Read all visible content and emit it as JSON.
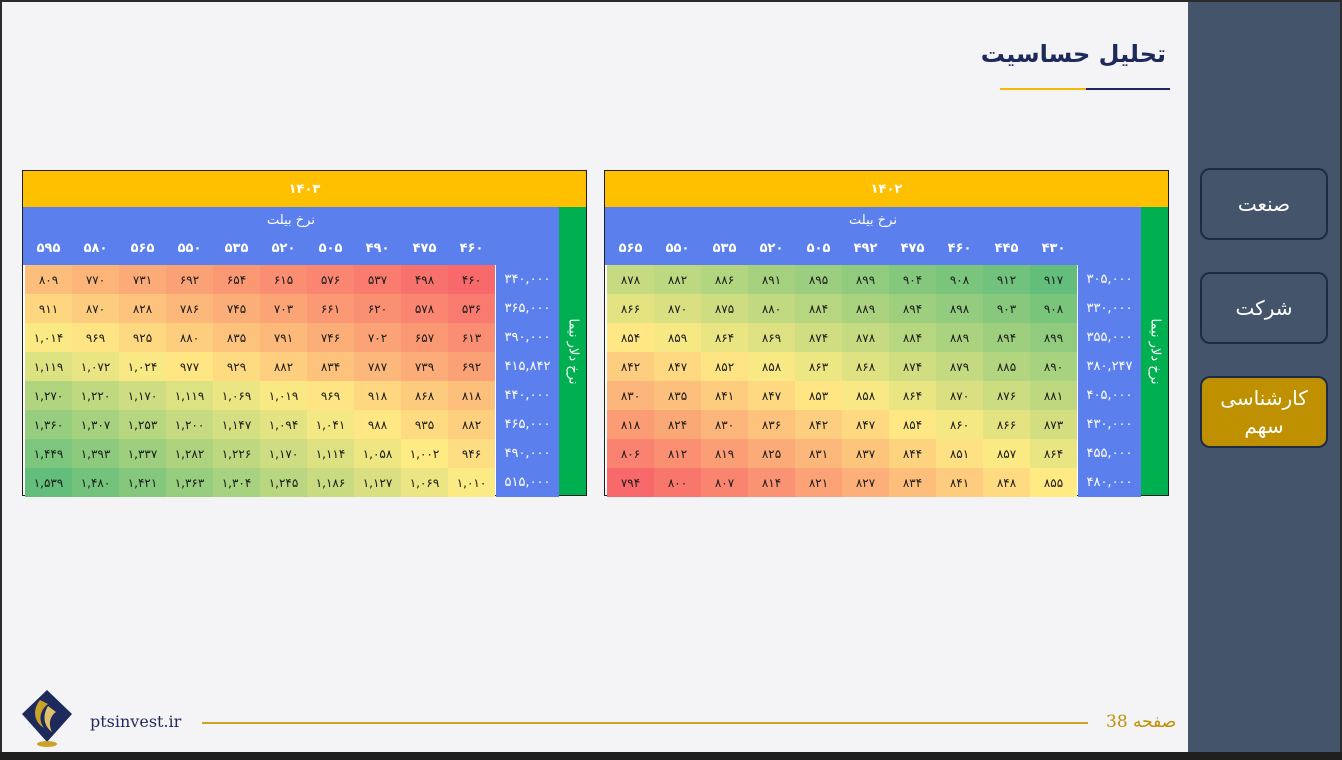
{
  "title": "تحلیل حساسیت",
  "nav": [
    {
      "label": "صنعت",
      "active": false
    },
    {
      "label": "شرکت",
      "active": false
    },
    {
      "label": "کارشناسی سهم",
      "active": true
    }
  ],
  "footer": {
    "site": "ptsinvest.ir",
    "page": "صفحه 38"
  },
  "ticket_label": "نرخ بیلت",
  "dollar_label": "نرخ دلار نیما",
  "colors": {
    "red": "#f8696b",
    "yellow": "#ffeb84",
    "green": "#63be7b",
    "header_blue": "#5b80ee",
    "header_gold": "#ffc000",
    "side_green": "#00b050"
  },
  "tables": [
    {
      "year": "۱۴۰۳",
      "low_is_red": true,
      "cols": [
        "۴۶۰",
        "۴۷۵",
        "۴۹۰",
        "۵۰۵",
        "۵۲۰",
        "۵۳۵",
        "۵۵۰",
        "۵۶۵",
        "۵۸۰",
        "۵۹۵"
      ],
      "rows": [
        "۳۴۰,۰۰۰",
        "۳۶۵,۰۰۰",
        "۳۹۰,۰۰۰",
        "۴۱۵,۸۴۲",
        "۴۴۰,۰۰۰",
        "۴۶۵,۰۰۰",
        "۴۹۰,۰۰۰",
        "۵۱۵,۰۰۰"
      ],
      "cells": [
        [
          "۴۶۰",
          "۴۹۸",
          "۵۳۷",
          "۵۷۶",
          "۶۱۵",
          "۶۵۴",
          "۶۹۲",
          "۷۳۱",
          "۷۷۰",
          "۸۰۹"
        ],
        [
          "۵۳۶",
          "۵۷۸",
          "۶۲۰",
          "۶۶۱",
          "۷۰۳",
          "۷۴۵",
          "۷۸۶",
          "۸۲۸",
          "۸۷۰",
          "۹۱۱"
        ],
        [
          "۶۱۳",
          "۶۵۷",
          "۷۰۲",
          "۷۴۶",
          "۷۹۱",
          "۸۳۵",
          "۸۸۰",
          "۹۲۵",
          "۹۶۹",
          "۱,۰۱۴"
        ],
        [
          "۶۹۲",
          "۷۳۹",
          "۷۸۷",
          "۸۳۴",
          "۸۸۲",
          "۹۲۹",
          "۹۷۷",
          "۱,۰۲۴",
          "۱,۰۷۲",
          "۱,۱۱۹"
        ],
        [
          "۸۱۸",
          "۸۶۸",
          "۹۱۸",
          "۹۶۹",
          "۱,۰۱۹",
          "۱,۰۶۹",
          "۱,۱۱۹",
          "۱,۱۷۰",
          "۱,۲۲۰",
          "۱,۲۷۰"
        ],
        [
          "۸۸۲",
          "۹۳۵",
          "۹۸۸",
          "۱,۰۴۱",
          "۱,۰۹۴",
          "۱,۱۴۷",
          "۱,۲۰۰",
          "۱,۲۵۳",
          "۱,۳۰۷",
          "۱,۳۶۰"
        ],
        [
          "۹۴۶",
          "۱,۰۰۲",
          "۱,۰۵۸",
          "۱,۱۱۴",
          "۱,۱۷۰",
          "۱,۲۲۶",
          "۱,۲۸۲",
          "۱,۳۳۷",
          "۱,۳۹۳",
          "۱,۴۴۹"
        ],
        [
          "۱,۰۱۰",
          "۱,۰۶۹",
          "۱,۱۲۷",
          "۱,۱۸۶",
          "۱,۲۴۵",
          "۱,۳۰۴",
          "۱,۳۶۳",
          "۱,۴۲۱",
          "۱,۴۸۰",
          "۱,۵۳۹"
        ]
      ]
    },
    {
      "year": "۱۴۰۲",
      "low_is_red": true,
      "cols": [
        "۴۳۰",
        "۴۴۵",
        "۴۶۰",
        "۴۷۵",
        "۴۹۲",
        "۵۰۵",
        "۵۲۰",
        "۵۳۵",
        "۵۵۰",
        "۵۶۵"
      ],
      "rows": [
        "۳۰۵,۰۰۰",
        "۳۳۰,۰۰۰",
        "۳۵۵,۰۰۰",
        "۳۸۰,۲۴۷",
        "۴۰۵,۰۰۰",
        "۴۳۰,۰۰۰",
        "۴۵۵,۰۰۰",
        "۴۸۰,۰۰۰"
      ],
      "cells": [
        [
          "۹۱۷",
          "۹۱۲",
          "۹۰۸",
          "۹۰۴",
          "۸۹۹",
          "۸۹۵",
          "۸۹۱",
          "۸۸۶",
          "۸۸۲",
          "۸۷۸"
        ],
        [
          "۹۰۸",
          "۹۰۳",
          "۸۹۸",
          "۸۹۴",
          "۸۸۹",
          "۸۸۴",
          "۸۸۰",
          "۸۷۵",
          "۸۷۰",
          "۸۶۶"
        ],
        [
          "۸۹۹",
          "۸۹۴",
          "۸۸۹",
          "۸۸۴",
          "۸۷۸",
          "۸۷۴",
          "۸۶۹",
          "۸۶۴",
          "۸۵۹",
          "۸۵۴"
        ],
        [
          "۸۹۰",
          "۸۸۵",
          "۸۷۹",
          "۸۷۴",
          "۸۶۸",
          "۸۶۳",
          "۸۵۸",
          "۸۵۲",
          "۸۴۷",
          "۸۴۲"
        ],
        [
          "۸۸۱",
          "۸۷۶",
          "۸۷۰",
          "۸۶۴",
          "۸۵۸",
          "۸۵۳",
          "۸۴۷",
          "۸۴۱",
          "۸۳۵",
          "۸۳۰"
        ],
        [
          "۸۷۳",
          "۸۶۶",
          "۸۶۰",
          "۸۵۴",
          "۸۴۷",
          "۸۴۲",
          "۸۳۶",
          "۸۳۰",
          "۸۲۴",
          "۸۱۸"
        ],
        [
          "۸۶۴",
          "۸۵۷",
          "۸۵۱",
          "۸۴۴",
          "۸۳۷",
          "۸۳۱",
          "۸۲۵",
          "۸۱۹",
          "۸۱۲",
          "۸۰۶"
        ],
        [
          "۸۵۵",
          "۸۴۸",
          "۸۴۱",
          "۸۳۴",
          "۸۲۷",
          "۸۲۱",
          "۸۱۴",
          "۸۰۷",
          "۸۰۰",
          "۷۹۴"
        ]
      ]
    }
  ]
}
